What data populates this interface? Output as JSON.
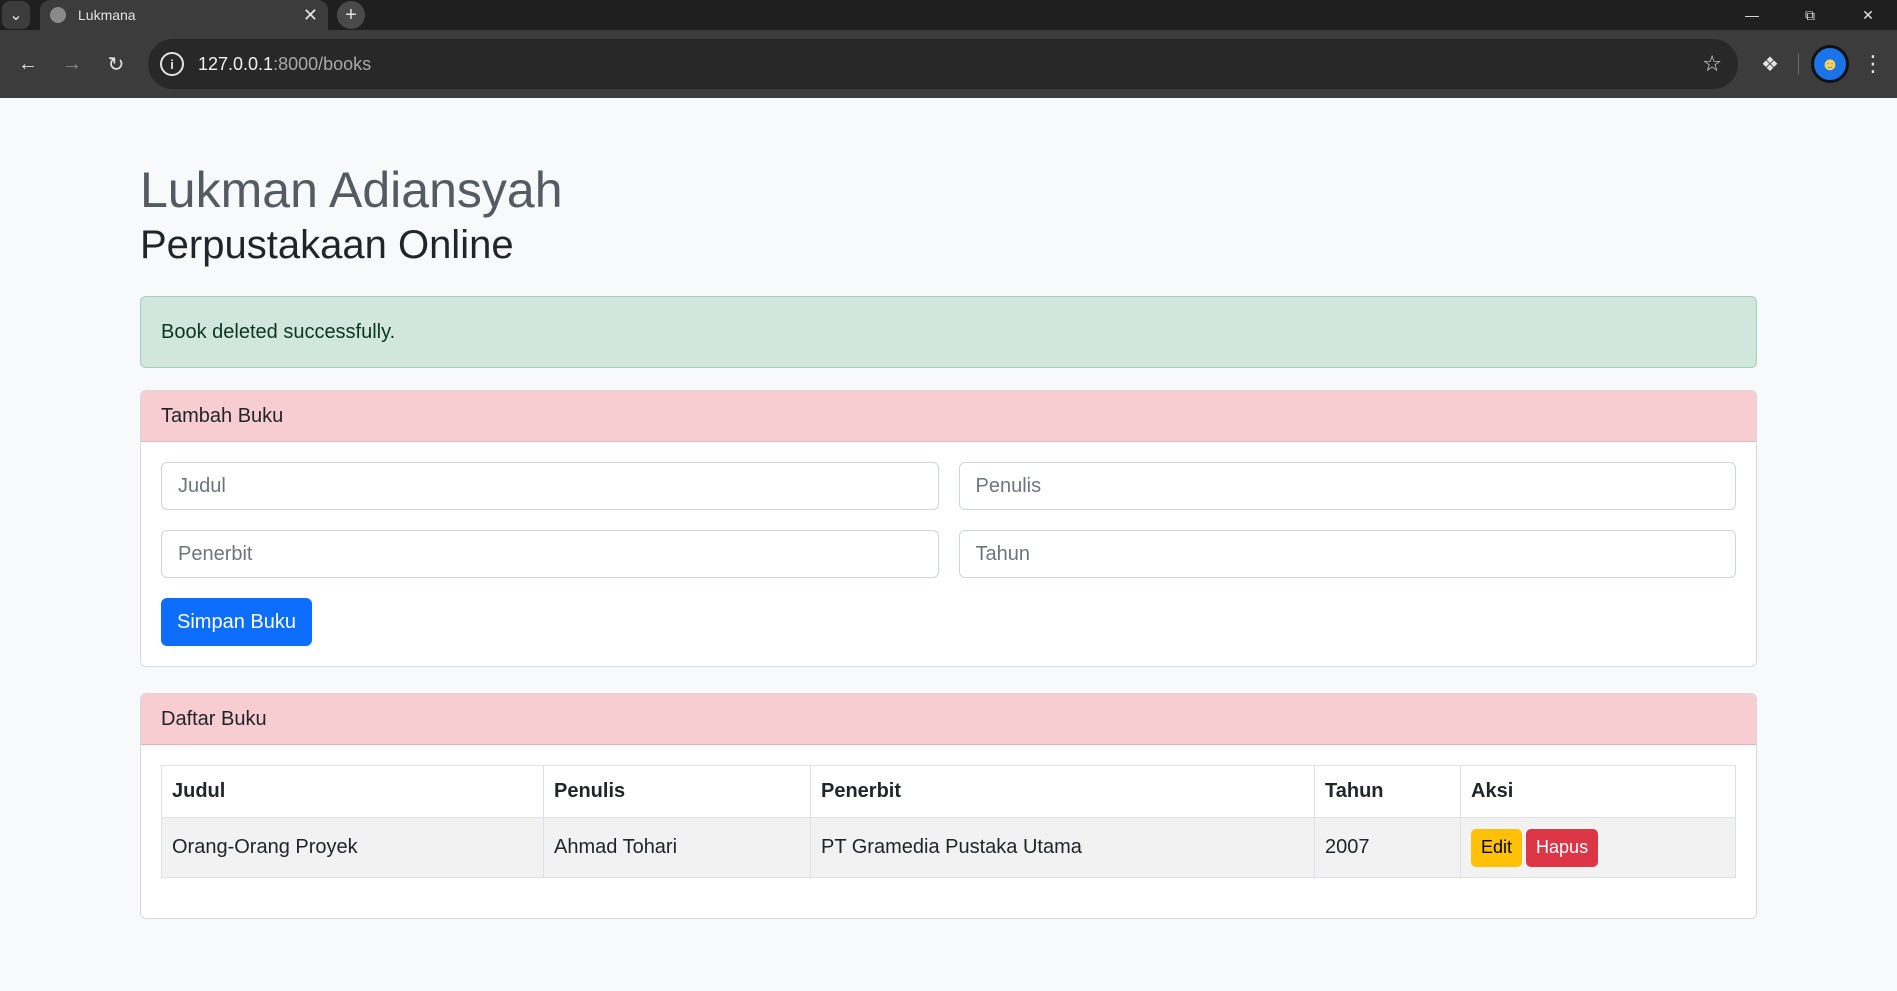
{
  "browser": {
    "tab_title": "Lukmana",
    "url_host": "127.0.0.1",
    "url_path": ":8000/books"
  },
  "page": {
    "name": "Lukman Adiansyah",
    "subtitle": "Perpustakaan Online"
  },
  "alert": {
    "message": "Book deleted successfully."
  },
  "add_form": {
    "header": "Tambah Buku",
    "judul_placeholder": "Judul",
    "penulis_placeholder": "Penulis",
    "penerbit_placeholder": "Penerbit",
    "tahun_placeholder": "Tahun",
    "submit_label": "Simpan Buku"
  },
  "book_list": {
    "header": "Daftar Buku",
    "columns": [
      "Judul",
      "Penulis",
      "Penerbit",
      "Tahun",
      "Aksi"
    ],
    "rows": [
      {
        "judul": "Orang-Orang Proyek",
        "penulis": "Ahmad Tohari",
        "penerbit": "PT Gramedia Pustaka Utama",
        "tahun": "2007",
        "edit_label": "Edit",
        "delete_label": "Hapus"
      }
    ]
  },
  "colors": {
    "card_header": "#f8cdd2",
    "alert_bg": "#d1e7dd",
    "primary": "#0d6efd",
    "warning": "#ffc107",
    "danger": "#dc3545"
  }
}
